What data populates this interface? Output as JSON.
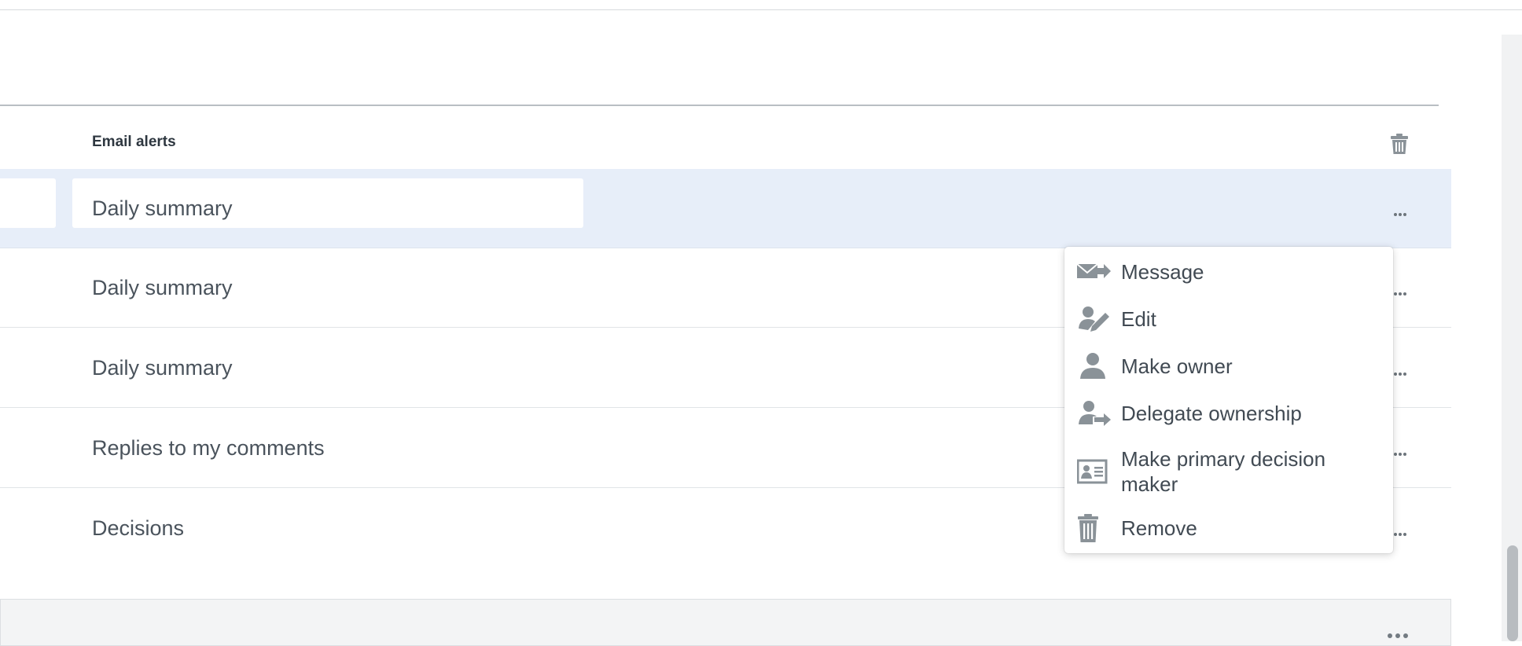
{
  "table": {
    "column_header": "Email alerts",
    "rows": [
      {
        "alert": "Daily summary"
      },
      {
        "alert": "Daily summary"
      },
      {
        "alert": "Daily summary"
      },
      {
        "alert": "Replies to my comments"
      },
      {
        "alert": "Decisions"
      }
    ]
  },
  "context_menu": {
    "items": [
      {
        "label": "Message",
        "icon": "message-send-icon"
      },
      {
        "label": "Edit",
        "icon": "edit-user-icon"
      },
      {
        "label": "Make owner",
        "icon": "owner-icon"
      },
      {
        "label": "Delegate ownership",
        "icon": "delegate-icon"
      },
      {
        "label": "Make primary decision maker",
        "icon": "id-card-icon"
      },
      {
        "label": "Remove",
        "icon": "trash-icon"
      }
    ]
  },
  "colors": {
    "selected_row": "#e7eef9",
    "icon_gray": "#8a9298",
    "text": "#4a535c"
  }
}
